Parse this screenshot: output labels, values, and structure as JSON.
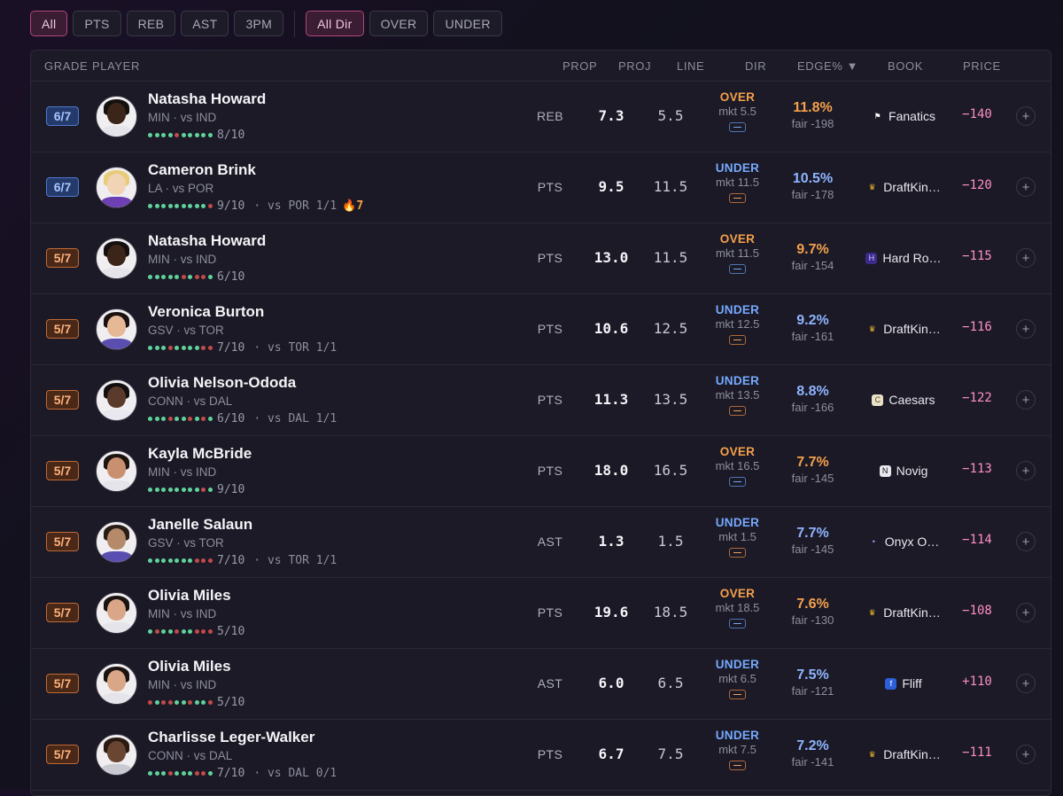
{
  "filters": {
    "stat": [
      {
        "label": "All",
        "active": true
      },
      {
        "label": "PTS",
        "active": false
      },
      {
        "label": "REB",
        "active": false
      },
      {
        "label": "AST",
        "active": false
      },
      {
        "label": "3PM",
        "active": false
      }
    ],
    "direction": [
      {
        "label": "All Dir",
        "active": true
      },
      {
        "label": "OVER",
        "active": false
      },
      {
        "label": "UNDER",
        "active": false
      }
    ]
  },
  "table": {
    "headers": {
      "grade": "GRADE",
      "player": "PLAYER",
      "prop": "PROP",
      "proj": "PROJ",
      "line": "LINE",
      "dir": "DIR",
      "edge": "EDGE% ▼",
      "book": "BOOK",
      "price": "PRICE"
    },
    "rows": [
      {
        "grade": "6/7",
        "name": "Natasha Howard",
        "team": "MIN · vs IND",
        "hits": [
          1,
          1,
          1,
          1,
          0,
          1,
          1,
          1,
          1,
          1
        ],
        "hit_rate": "8/10",
        "extra": "",
        "streak": "",
        "prop": "REB",
        "proj": "7.3",
        "line": "5.5",
        "dir": "OVER",
        "mkt": "mkt 5.5",
        "edge": "11.8%",
        "fair": "fair -198",
        "book": "Fanatics",
        "book_icon": "fanatics-icon",
        "price": "−140"
      },
      {
        "grade": "6/7",
        "name": "Cameron Brink",
        "team": "LA · vs POR",
        "hits": [
          1,
          1,
          1,
          1,
          1,
          1,
          1,
          1,
          1,
          0
        ],
        "hit_rate": "9/10",
        "extra": "·  vs POR 1/1",
        "streak": "🔥7",
        "prop": "PTS",
        "proj": "9.5",
        "line": "11.5",
        "dir": "UNDER",
        "mkt": "mkt 11.5",
        "edge": "10.5%",
        "fair": "fair -178",
        "book": "DraftKin…",
        "book_icon": "draftkings-icon",
        "price": "−120"
      },
      {
        "grade": "5/7",
        "name": "Natasha Howard",
        "team": "MIN · vs IND",
        "hits": [
          1,
          1,
          1,
          1,
          1,
          0,
          1,
          0,
          0,
          1
        ],
        "hit_rate": "6/10",
        "extra": "",
        "streak": "",
        "prop": "PTS",
        "proj": "13.0",
        "line": "11.5",
        "dir": "OVER",
        "mkt": "mkt 11.5",
        "edge": "9.7%",
        "fair": "fair -154",
        "book": "Hard Ro…",
        "book_icon": "hardrock-icon",
        "price": "−115"
      },
      {
        "grade": "5/7",
        "name": "Veronica Burton",
        "team": "GSV · vs TOR",
        "hits": [
          1,
          1,
          1,
          0,
          1,
          1,
          1,
          1,
          0,
          0
        ],
        "hit_rate": "7/10",
        "extra": "·  vs TOR 1/1",
        "streak": "",
        "prop": "PTS",
        "proj": "10.6",
        "line": "12.5",
        "dir": "UNDER",
        "mkt": "mkt 12.5",
        "edge": "9.2%",
        "fair": "fair -161",
        "book": "DraftKin…",
        "book_icon": "draftkings-icon",
        "price": "−116"
      },
      {
        "grade": "5/7",
        "name": "Olivia Nelson-Ododa",
        "team": "CONN · vs DAL",
        "hits": [
          1,
          1,
          1,
          0,
          1,
          1,
          0,
          1,
          0,
          1
        ],
        "hit_rate": "6/10",
        "extra": "·  vs DAL 1/1",
        "streak": "",
        "prop": "PTS",
        "proj": "11.3",
        "line": "13.5",
        "dir": "UNDER",
        "mkt": "mkt 13.5",
        "edge": "8.8%",
        "fair": "fair -166",
        "book": "Caesars",
        "book_icon": "caesars-icon",
        "price": "−122"
      },
      {
        "grade": "5/7",
        "name": "Kayla McBride",
        "team": "MIN · vs IND",
        "hits": [
          1,
          1,
          1,
          1,
          1,
          1,
          1,
          1,
          0,
          1
        ],
        "hit_rate": "9/10",
        "extra": "",
        "streak": "",
        "prop": "PTS",
        "proj": "18.0",
        "line": "16.5",
        "dir": "OVER",
        "mkt": "mkt 16.5",
        "edge": "7.7%",
        "fair": "fair -145",
        "book": "Novig",
        "book_icon": "novig-icon",
        "price": "−113"
      },
      {
        "grade": "5/7",
        "name": "Janelle Salaun",
        "team": "GSV · vs TOR",
        "hits": [
          1,
          1,
          1,
          1,
          1,
          1,
          1,
          0,
          0,
          0
        ],
        "hit_rate": "7/10",
        "extra": "·  vs TOR 1/1",
        "streak": "",
        "prop": "AST",
        "proj": "1.3",
        "line": "1.5",
        "dir": "UNDER",
        "mkt": "mkt 1.5",
        "edge": "7.7%",
        "fair": "fair -145",
        "book": "Onyx O…",
        "book_icon": "onyx-icon",
        "price": "−114"
      },
      {
        "grade": "5/7",
        "name": "Olivia Miles",
        "team": "MIN · vs IND",
        "hits": [
          1,
          0,
          1,
          1,
          0,
          1,
          1,
          0,
          0,
          0
        ],
        "hit_rate": "5/10",
        "extra": "",
        "streak": "",
        "prop": "PTS",
        "proj": "19.6",
        "line": "18.5",
        "dir": "OVER",
        "mkt": "mkt 18.5",
        "edge": "7.6%",
        "fair": "fair -130",
        "book": "DraftKin…",
        "book_icon": "draftkings-icon",
        "price": "−108"
      },
      {
        "grade": "5/7",
        "name": "Olivia Miles",
        "team": "MIN · vs IND",
        "hits": [
          0,
          1,
          0,
          0,
          1,
          1,
          0,
          1,
          1,
          0
        ],
        "hit_rate": "5/10",
        "extra": "",
        "streak": "",
        "prop": "AST",
        "proj": "6.0",
        "line": "6.5",
        "dir": "UNDER",
        "mkt": "mkt 6.5",
        "edge": "7.5%",
        "fair": "fair -121",
        "book": "Fliff",
        "book_icon": "fliff-icon",
        "price": "+110"
      },
      {
        "grade": "5/7",
        "name": "Charlisse Leger-Walker",
        "team": "CONN · vs DAL",
        "hits": [
          1,
          1,
          1,
          0,
          1,
          1,
          1,
          0,
          0,
          1
        ],
        "hit_rate": "7/10",
        "extra": "·  vs DAL 0/1",
        "streak": "",
        "prop": "PTS",
        "proj": "6.7",
        "line": "7.5",
        "dir": "UNDER",
        "mkt": "mkt 7.5",
        "edge": "7.2%",
        "fair": "fair -141",
        "book": "DraftKin…",
        "book_icon": "draftkings-icon",
        "price": "−111"
      }
    ]
  },
  "colors": {
    "over": "#f5a04c",
    "under": "#76a9ff",
    "price": "#ff8ec7",
    "hit": "#5fd39b",
    "miss": "#c24a4a",
    "grade6": "#4f79d0",
    "grade5": "#c06a35",
    "accent": "#b0457d"
  }
}
